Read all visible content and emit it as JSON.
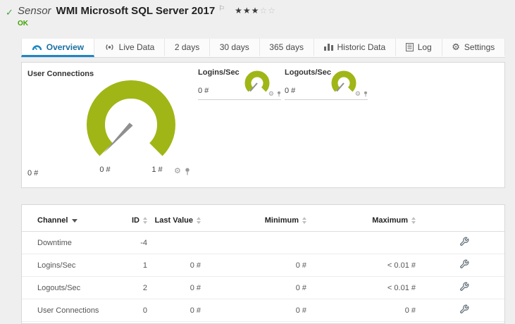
{
  "icons": {
    "check": "✓",
    "flag": "⚐",
    "gear": "⚙"
  },
  "header": {
    "kind_label": "Sensor",
    "title": "WMI Microsoft SQL Server 2017",
    "priority": {
      "filled_stars": "★★★",
      "empty_stars": "☆☆"
    },
    "status_text": "OK"
  },
  "tabs": [
    {
      "label": "Overview",
      "active": true
    },
    {
      "label": "Live Data",
      "active": false
    },
    {
      "label": "2 days",
      "active": false
    },
    {
      "label": "30 days",
      "active": false
    },
    {
      "label": "365 days",
      "active": false
    },
    {
      "label": "Historic Data",
      "active": false
    },
    {
      "label": "Log",
      "active": false
    },
    {
      "label": "Settings",
      "active": false
    }
  ],
  "gauges": {
    "main": {
      "title": "User Connections",
      "value": "0 #",
      "scale_min": "0 #",
      "scale_max": "1 #"
    },
    "small": [
      {
        "title": "Logins/Sec",
        "value": "0 #"
      },
      {
        "title": "Logouts/Sec",
        "value": "0 #"
      }
    ]
  },
  "table": {
    "columns": {
      "channel": "Channel",
      "id": "ID",
      "last_value": "Last Value",
      "minimum": "Minimum",
      "maximum": "Maximum"
    },
    "rows": [
      {
        "channel": "Downtime",
        "id": "-4",
        "last_value": "",
        "minimum": "",
        "maximum": ""
      },
      {
        "channel": "Logins/Sec",
        "id": "1",
        "last_value": "0 #",
        "minimum": "0 #",
        "maximum": "< 0.01 #"
      },
      {
        "channel": "Logouts/Sec",
        "id": "2",
        "last_value": "0 #",
        "minimum": "0 #",
        "maximum": "< 0.01 #"
      },
      {
        "channel": "User Connections",
        "id": "0",
        "last_value": "0 #",
        "minimum": "0 #",
        "maximum": "0 #"
      }
    ]
  },
  "colors": {
    "gauge_green": "#a0b616",
    "active_tab_blue": "#1e86c4",
    "status_ok_green": "#3fa300"
  }
}
